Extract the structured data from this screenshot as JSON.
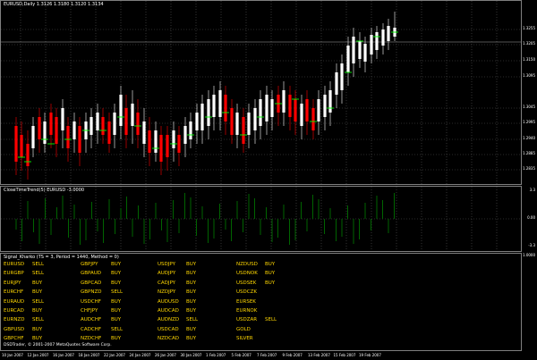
{
  "main": {
    "title": "EURUSD,Daily 1.3126 1.3180 1.3120 1.3134",
    "price_scale": [
      "1.3255",
      "1.3205",
      "1.3150",
      "1.3095",
      "1.3045",
      "1.2995",
      "1.2940",
      "1.2885",
      "1.2835"
    ],
    "current_price": "1.3134"
  },
  "indicator": {
    "title": "CloseTimeTrend(5) EURUSD -3.0000",
    "scale": [
      "3.3",
      "0.00",
      "-3.3"
    ]
  },
  "signal": {
    "title": "Signal_Kharko (TS = 3, Period = 1440, Method = 0)",
    "scale_top": "1.0000",
    "copyright": "DSDTrader, © 2001-2007 MetaQuotes Software Corp.",
    "rows": [
      [
        [
          "EURUSD",
          "SELL"
        ],
        [
          "GBPJPY",
          "BUY"
        ],
        [
          "USDJPY",
          "BUY"
        ],
        [
          "NZDUSD",
          "BUY"
        ]
      ],
      [
        [
          "EURGBP",
          "SELL"
        ],
        [
          "GBPAUD",
          "BUY"
        ],
        [
          "AUDJPY",
          "BUY"
        ],
        [
          "USDNOK",
          "BUY"
        ]
      ],
      [
        [
          "EURJPY",
          "BUY"
        ],
        [
          "GBPCAD",
          "BUY"
        ],
        [
          "CADJPY",
          "BUY"
        ],
        [
          "USDSEK",
          "BUY"
        ]
      ],
      [
        [
          "EURCHF",
          "BUY"
        ],
        [
          "GBPNZD",
          "SELL"
        ],
        [
          "NZDJPY",
          "BUY"
        ],
        [
          "USDCZK",
          ""
        ]
      ],
      [
        [
          "EURAUD",
          "SELL"
        ],
        [
          "USDCHF",
          "BUY"
        ],
        [
          "AUDUSD",
          "BUY"
        ],
        [
          "EURSEK",
          ""
        ]
      ],
      [
        [
          "EURCAD",
          "BUY"
        ],
        [
          "CHFJPY",
          "BUY"
        ],
        [
          "AUDCAD",
          "BUY"
        ],
        [
          "EURNOK",
          ""
        ]
      ],
      [
        [
          "EURNZD",
          "SELL"
        ],
        [
          "AUDCHF",
          "BUY"
        ],
        [
          "AUDNZD",
          "SELL"
        ],
        [
          "USDZAR",
          "SELL"
        ]
      ],
      [
        [
          "GBPUSD",
          "BUY"
        ],
        [
          "CADCHF",
          "SELL"
        ],
        [
          "USDCAD",
          "BUY"
        ],
        [
          "GOLD",
          ""
        ]
      ],
      [
        [
          "GBPCHF",
          "BUY"
        ],
        [
          "NZDCHF",
          "BUY"
        ],
        [
          "NZDCAD",
          "BUY"
        ],
        [
          "SILVER",
          ""
        ]
      ]
    ]
  },
  "dates": [
    "10 Jan 2007",
    "12 Jan 2007",
    "16 Jan 2007",
    "18 Jan 2007",
    "22 Jan 2007",
    "24 Jan 2007",
    "26 Jan 2007",
    "30 Jan 2007",
    "1 Feb 2007",
    "5 Feb 2007",
    "7 Feb 2007",
    "9 Feb 2007",
    "13 Feb 2007",
    "15 Feb 2007",
    "19 Feb 2007"
  ],
  "colors": {
    "bull": "#ffffff",
    "bear": "#ff0000",
    "ma": "#00ff00",
    "indicator": "#006400",
    "pair": "#2e6bff",
    "signal_text": "#ffd700",
    "grid": "#555555"
  }
}
